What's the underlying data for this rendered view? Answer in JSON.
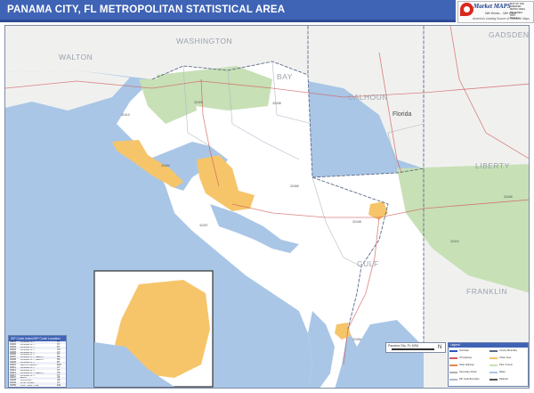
{
  "header": {
    "title": "PANAMA CITY, FL METROPOLITAN STATISTICAL AREA"
  },
  "logo": {
    "name": "Market MAPS",
    "tagline": "We Know... We Care",
    "subtagline": "America's Leading Source of Research Maps",
    "info_lines": [
      "MAP OF THE GREATER",
      "METRO AREA",
      "ZIP CODES",
      "2013",
      "SCALE 1:"
    ]
  },
  "map": {
    "county_labels": [
      "WALTON",
      "WASHINGTON",
      "CALHOUN",
      "GADSDEN",
      "LIBERTY",
      "GULF",
      "FRANKLIN",
      "BAY"
    ],
    "city_labels": [
      "Florida"
    ],
    "zip_labels": [
      "32413",
      "32409",
      "32438",
      "32466",
      "32448",
      "32456",
      "32465",
      "32410",
      "32404",
      "32407"
    ],
    "colors": {
      "water": "#a9c6e6",
      "land": "#ffffff",
      "outside_land": "#f0f1ef",
      "urban": "#f6c56a",
      "park": "#c7e0b5",
      "county_line": "#5c6a8a",
      "zip_line": "#b3b9c8",
      "road": "#d25a5a"
    }
  },
  "zip_table": {
    "title": "ZIP Code Index/ZIP Code Location",
    "rows": [
      [
        "32401",
        "PANAMA CITY",
        "C7"
      ],
      [
        "32402",
        "PANAMA CITY",
        "C7"
      ],
      [
        "32403",
        "PANAMA CITY",
        "D7"
      ],
      [
        "32404",
        "PANAMA CITY",
        "C8"
      ],
      [
        "32405",
        "PANAMA CITY",
        "C7"
      ],
      [
        "32406",
        "PANAMA CITY",
        "C7"
      ],
      [
        "32407",
        "PANAMA CITY BEACH",
        "D6"
      ],
      [
        "32408",
        "PANAMA CITY BEACH",
        "D6"
      ],
      [
        "32409",
        "PANAMA CITY",
        "B7"
      ],
      [
        "32410",
        "MEXICO BEACH",
        "E10"
      ],
      [
        "32411",
        "PANAMA CITY",
        "C7"
      ],
      [
        "32412",
        "PANAMA CITY",
        "C7"
      ],
      [
        "32413",
        "PANAMA CITY BEACH",
        "C5"
      ],
      [
        "32417",
        "PANAMA CITY",
        "C7"
      ],
      [
        "32437",
        "EBRO",
        "A5"
      ],
      [
        "32438",
        "FOUNTAIN",
        "A8"
      ],
      [
        "32444",
        "LYNN HAVEN",
        "C7"
      ],
      [
        "32456",
        "PORT SAINT JOE",
        "E11"
      ],
      [
        "32465",
        "WEWAHITCHKA",
        "B11"
      ],
      [
        "32466",
        "YOUNGSTOWN",
        "B8"
      ]
    ]
  },
  "scale": {
    "label": "Panama City, FL MSA",
    "compass": "N"
  },
  "legend": {
    "title": "Legend",
    "items": [
      {
        "label": "Interstate",
        "color": "#2b55b8"
      },
      {
        "label": "US Highway",
        "color": "#d25a5a"
      },
      {
        "label": "State Highway",
        "color": "#e08a4a"
      },
      {
        "label": "Secondary Road",
        "color": "#b0b0b0"
      },
      {
        "label": "ZIP Code Boundary",
        "color": "#b3b9c8"
      },
      {
        "label": "County Boundary",
        "color": "#5c6a8a"
      },
      {
        "label": "Urban Area",
        "color": "#f6c56a"
      },
      {
        "label": "Park / Forest",
        "color": "#c7e0b5"
      },
      {
        "label": "Water",
        "color": "#a9c6e6"
      },
      {
        "label": "Railroad",
        "color": "#555555"
      }
    ]
  }
}
